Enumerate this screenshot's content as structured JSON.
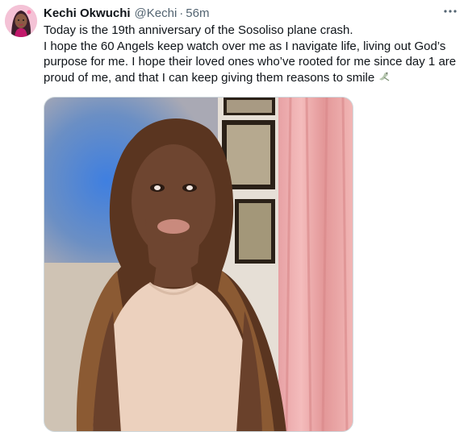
{
  "author": {
    "name": "Kechi Okwuchi",
    "handle": "@Kechi",
    "separator": "·",
    "time": "56m"
  },
  "tweet": {
    "line1": "Today is the 19th anniversary of the Sosoliso plane crash.",
    "line2": "I hope the 60 Angels keep watch over me as I navigate life, living out God’s purpose for me. I hope their loved ones who’ve rooted for me since day 1 are proud of me, and that I can keep giving them reasons to smile",
    "emoji": "dove-icon"
  },
  "icons": {
    "more": "more-horizontal-icon",
    "avatar": "avatar"
  },
  "colors": {
    "text": "#0f1419",
    "secondary": "#536471",
    "border": "#cfd9de"
  }
}
